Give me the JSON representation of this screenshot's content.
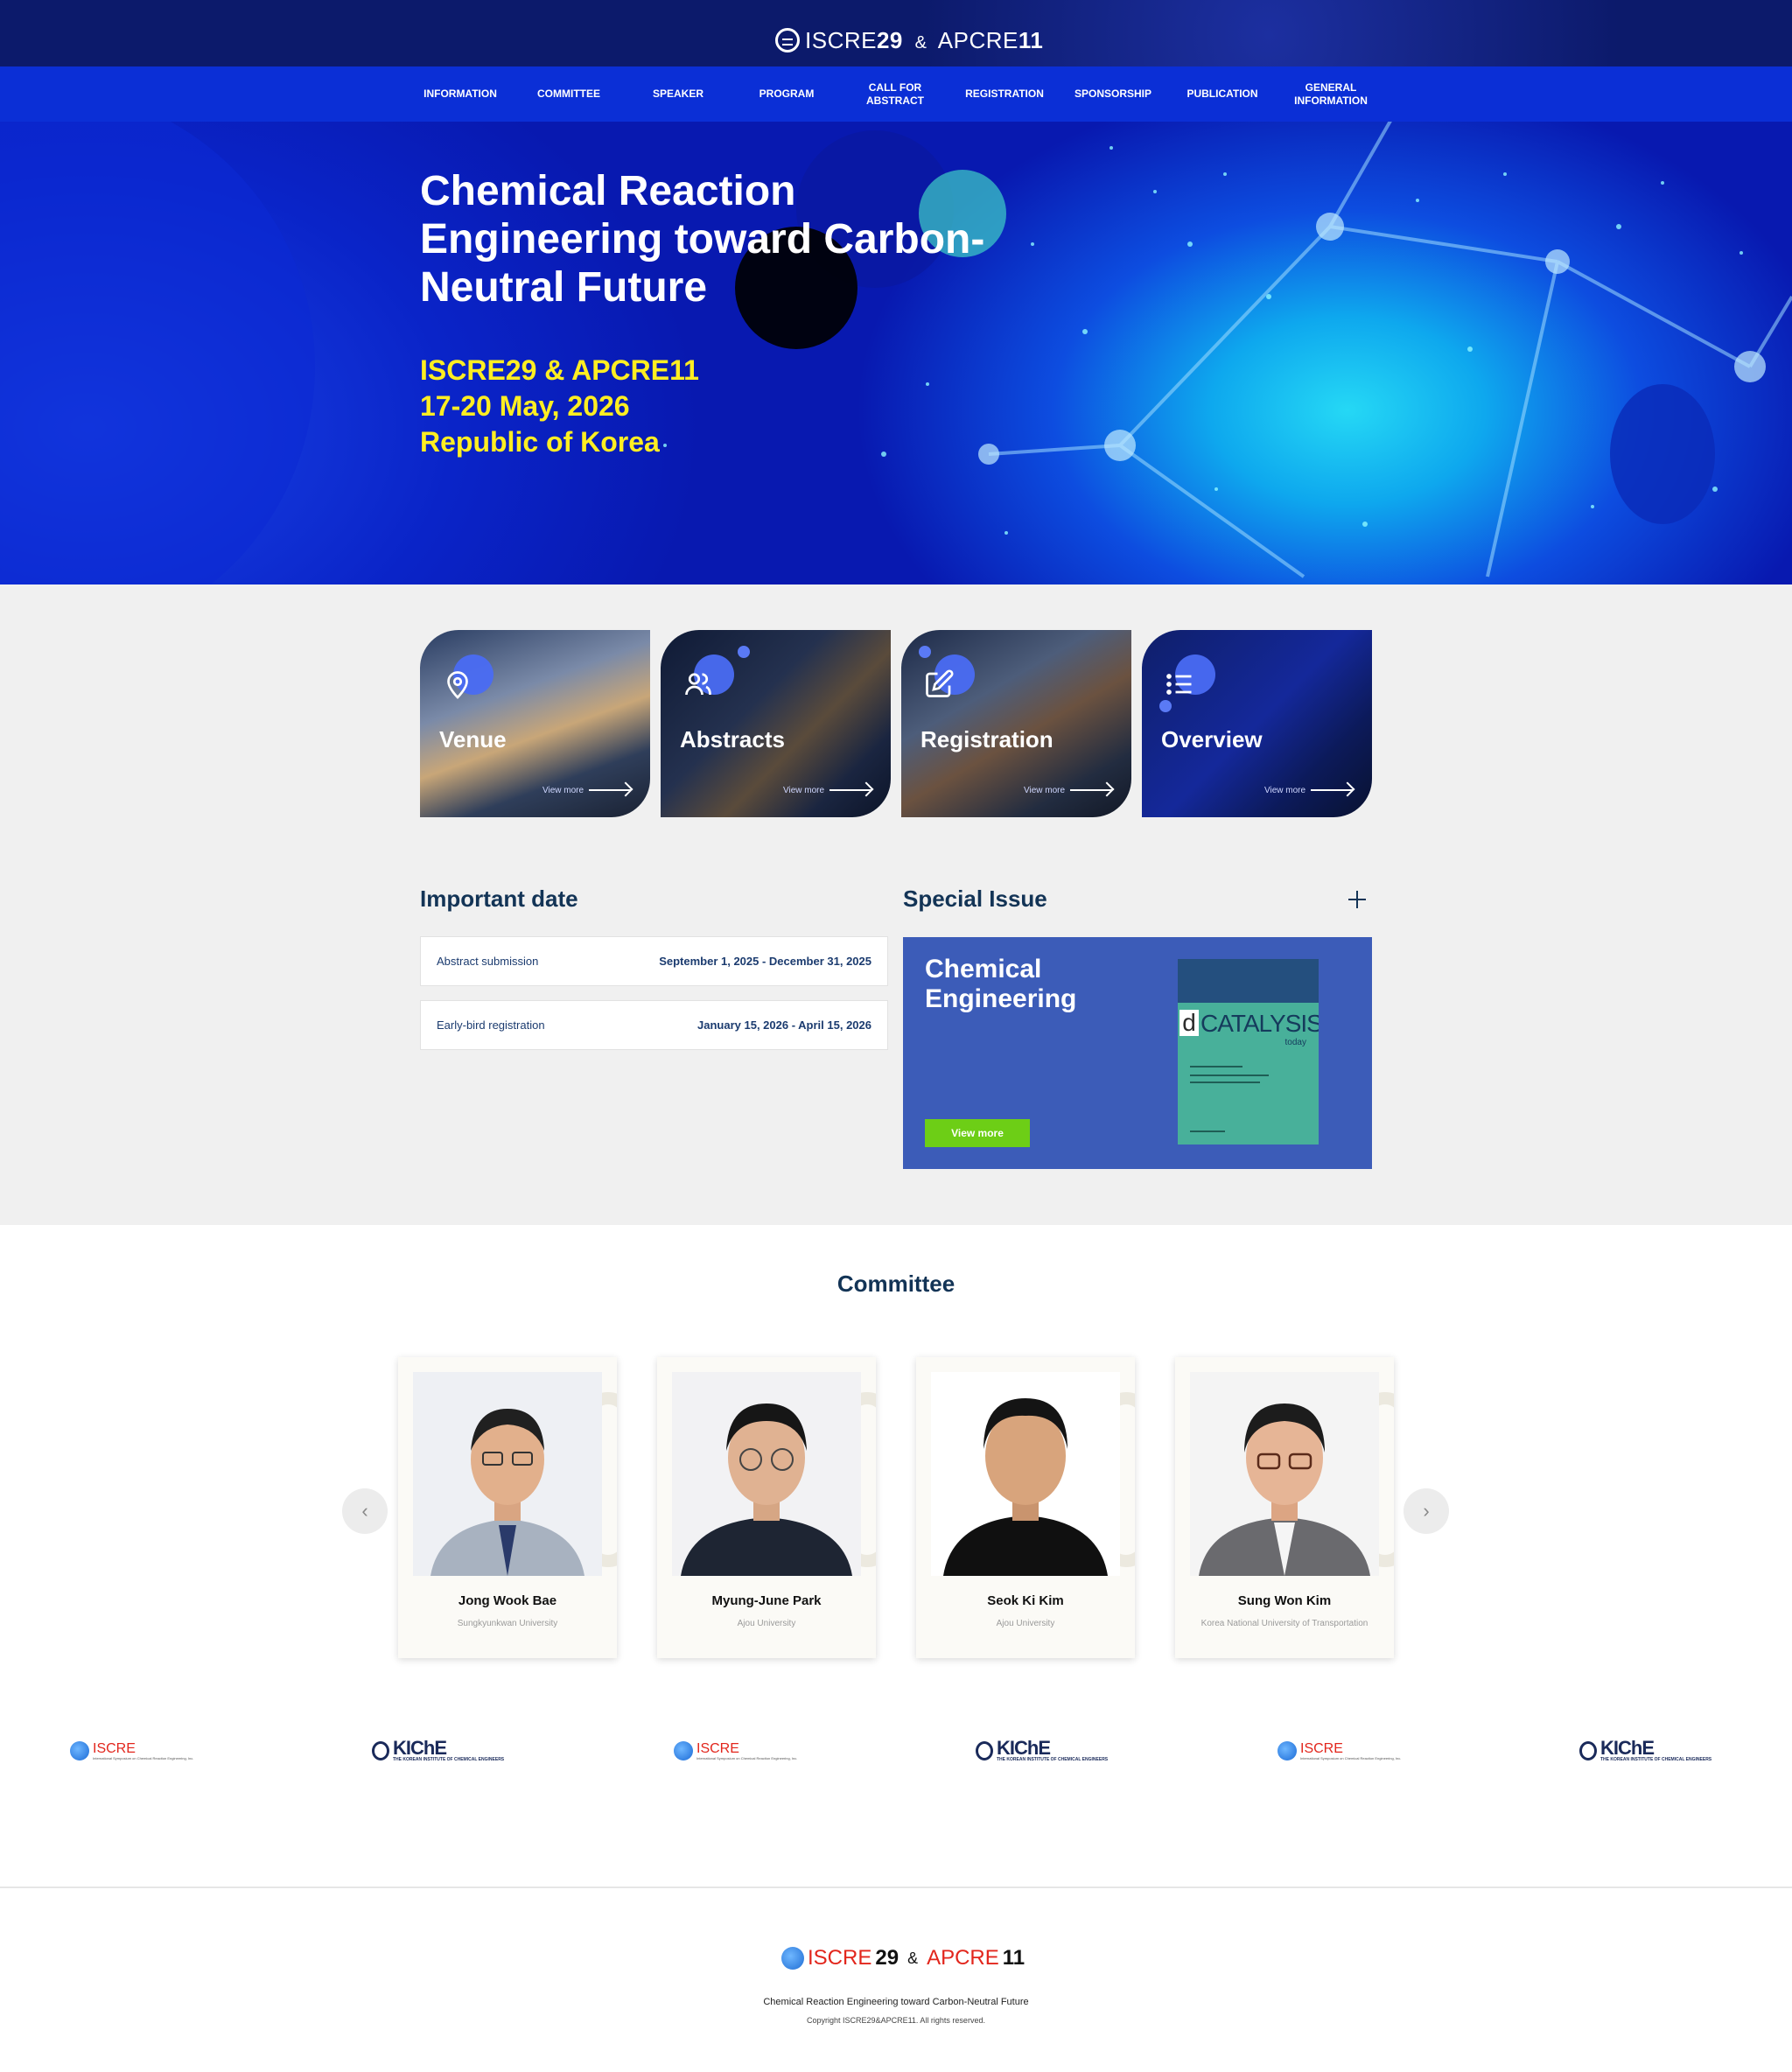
{
  "header": {
    "logo_left": "ISCRE",
    "logo_left_num": "29",
    "logo_amp": "&",
    "logo_right": "APCRE",
    "logo_right_num": "11"
  },
  "nav": [
    {
      "label": "INFORMATION"
    },
    {
      "label": "COMMITTEE"
    },
    {
      "label": "SPEAKER"
    },
    {
      "label": "PROGRAM"
    },
    {
      "label": "CALL FOR ABSTRACT"
    },
    {
      "label": "REGISTRATION"
    },
    {
      "label": "SPONSORSHIP"
    },
    {
      "label": "PUBLICATION"
    },
    {
      "label": "GENERAL INFORMATION"
    }
  ],
  "hero": {
    "title_line1": "Chemical Reaction",
    "title_line2": "Engineering toward Carbon-",
    "title_line3": "Neutral Future",
    "sub_line1": "ISCRE29 & APCRE11",
    "sub_line2": "17-20 May, 2026",
    "sub_line3": "Republic of Korea"
  },
  "quick_cards": [
    {
      "label": "Venue",
      "more": "View more",
      "icon": "location-pin-icon"
    },
    {
      "label": "Abstracts",
      "more": "View more",
      "icon": "users-icon"
    },
    {
      "label": "Registration",
      "more": "View more",
      "icon": "edit-icon"
    },
    {
      "label": "Overview",
      "more": "View more",
      "icon": "list-icon"
    }
  ],
  "important_date": {
    "title": "Important date",
    "rows": [
      {
        "label": "Abstract submission",
        "date": "September 1, 2025 - December 31, 2025"
      },
      {
        "label": "Early-bird registration",
        "date": "January 15, 2026 - April 15, 2026"
      }
    ]
  },
  "special_issue": {
    "title": "Special Issue",
    "card_title": "Chemical Engineering",
    "button": "View more",
    "journal_name": "CATALYSIS",
    "journal_sub": "today"
  },
  "committee": {
    "title": "Committee",
    "prev_icon": "chevron-left-icon",
    "next_icon": "chevron-right-icon",
    "members": [
      {
        "name": "Jong Wook Bae",
        "affiliation": "Sungkyunkwan University"
      },
      {
        "name": "Myung-June Park",
        "affiliation": "Ajou University"
      },
      {
        "name": "Seok Ki Kim",
        "affiliation": "Ajou University"
      },
      {
        "name": "Sung Won Kim",
        "affiliation": "Korea National University of Transportation"
      }
    ]
  },
  "partners": {
    "iscre": "ISCRE",
    "iscre_sub": "International Symposium on Chemical Reaction Engineering, Inc.",
    "kiche": "KIChE",
    "kiche_sub": "THE KOREAN INSTITUTE OF CHEMICAL ENGINEERS"
  },
  "footer": {
    "logo_left": "ISCRE",
    "logo_left_num": "29",
    "logo_amp": "&",
    "logo_right": "APCRE",
    "logo_right_num": "11",
    "tagline": "Chemical Reaction Engineering toward Carbon-Neutral Future",
    "copyright": "Copyright ISCRE29&APCRE11. All rights reserved."
  },
  "colors": {
    "nav_bg": "#0b2fd6",
    "topbar_bg": "#0c1a6b",
    "hero_sub": "#ffee22",
    "special_bg": "#3c5cb8",
    "button_green": "#6dce16"
  }
}
